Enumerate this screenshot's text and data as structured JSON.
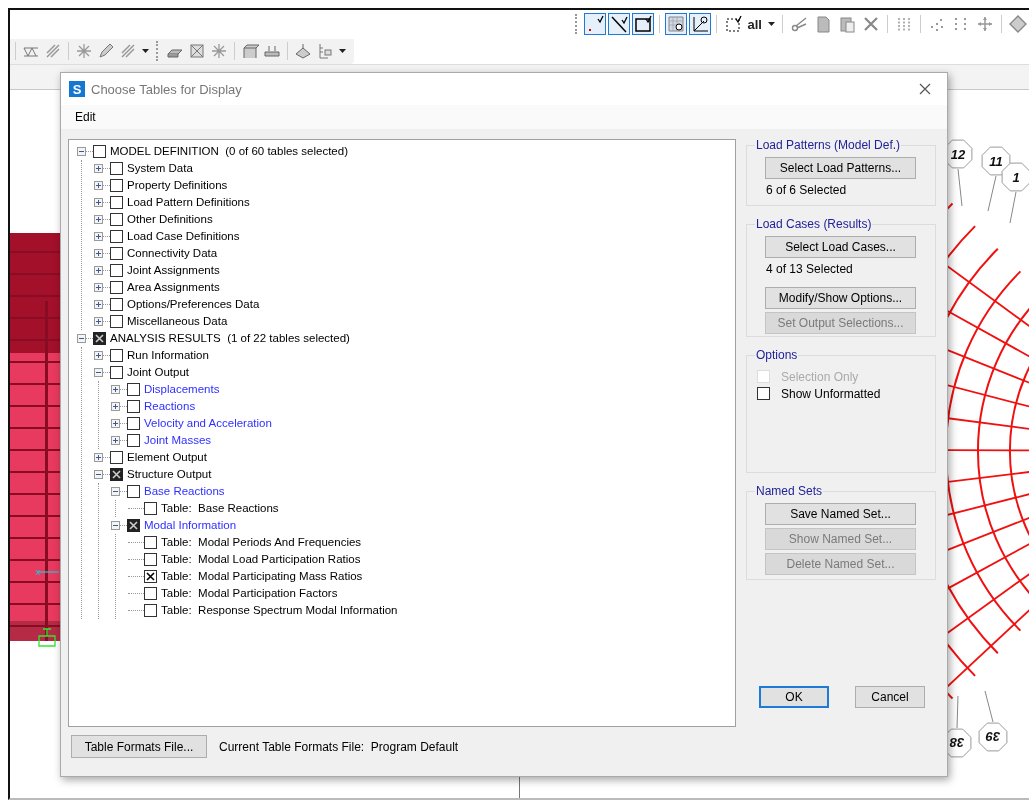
{
  "toolbar": {
    "buttons": [
      {
        "selected": true
      },
      {
        "selected": true
      },
      {
        "selected": true
      },
      {
        "selected": true
      },
      {
        "selected": true
      },
      {
        "selected": false
      },
      {
        "selected": false,
        "label": "all"
      },
      {
        "selected": false
      },
      {
        "selected": false
      },
      {
        "selected": false
      },
      {
        "selected": false
      },
      {
        "selected": false
      },
      {
        "selected": false
      },
      {
        "selected": false
      },
      {
        "selected": false
      }
    ]
  },
  "model_view": {
    "axis_label": "x"
  },
  "plan_view": {
    "top_bubbles": [
      "12",
      "11",
      "1"
    ],
    "bottom_bubbles": [
      "38",
      "39"
    ]
  },
  "dialog": {
    "icon_letter": "S",
    "title": "Choose Tables for Display",
    "menu": [
      "Edit"
    ],
    "tree": [
      {
        "label": "MODEL DEFINITION  (0 of 60 tables selected)",
        "expanded": true,
        "checked": false,
        "color": "#000000",
        "children": [
          {
            "label": "System Data",
            "expanded": false,
            "checked": false,
            "color": "#000000"
          },
          {
            "label": "Property Definitions",
            "expanded": false,
            "checked": false,
            "color": "#000000"
          },
          {
            "label": "Load Pattern Definitions",
            "expanded": false,
            "checked": false,
            "color": "#000000"
          },
          {
            "label": "Other Definitions",
            "expanded": false,
            "checked": false,
            "color": "#000000"
          },
          {
            "label": "Load Case Definitions",
            "expanded": false,
            "checked": false,
            "color": "#000000"
          },
          {
            "label": "Connectivity Data",
            "expanded": false,
            "checked": false,
            "color": "#000000"
          },
          {
            "label": "Joint Assignments",
            "expanded": false,
            "checked": false,
            "color": "#000000"
          },
          {
            "label": "Area Assignments",
            "expanded": false,
            "checked": false,
            "color": "#000000"
          },
          {
            "label": "Options/Preferences Data",
            "expanded": false,
            "checked": false,
            "color": "#000000"
          },
          {
            "label": "Miscellaneous Data",
            "expanded": false,
            "checked": false,
            "color": "#000000"
          }
        ]
      },
      {
        "label": "ANALYSIS RESULTS  (1 of 22 tables selected)",
        "expanded": true,
        "checked": true,
        "mixed": true,
        "color": "#000000",
        "children": [
          {
            "label": "Run Information",
            "expanded": false,
            "checked": false,
            "color": "#000000"
          },
          {
            "label": "Joint Output",
            "expanded": true,
            "checked": false,
            "color": "#000000",
            "children": [
              {
                "label": "Displacements",
                "expanded": false,
                "checked": false,
                "color": "#2f2fff"
              },
              {
                "label": "Reactions",
                "expanded": false,
                "checked": false,
                "color": "#2f2fff"
              },
              {
                "label": "Velocity and Acceleration",
                "expanded": false,
                "checked": false,
                "color": "#2f2fff"
              },
              {
                "label": "Joint Masses",
                "expanded": false,
                "checked": false,
                "color": "#2f2fff"
              }
            ]
          },
          {
            "label": "Element Output",
            "expanded": false,
            "checked": false,
            "color": "#000000"
          },
          {
            "label": "Structure Output",
            "expanded": true,
            "checked": true,
            "mixed": true,
            "color": "#000000",
            "children": [
              {
                "label": "Base Reactions",
                "expanded": true,
                "checked": false,
                "color": "#2f2fff",
                "children": [
                  {
                    "label": "Table:  Base Reactions",
                    "checked": false,
                    "color": "#000000"
                  }
                ]
              },
              {
                "label": "Modal Information",
                "expanded": true,
                "checked": true,
                "mixed": true,
                "color": "#2f2fff",
                "children": [
                  {
                    "label": "Table:  Modal Periods And Frequencies",
                    "checked": false,
                    "color": "#000000"
                  },
                  {
                    "label": "Table:  Modal Load Participation Ratios",
                    "checked": false,
                    "color": "#000000"
                  },
                  {
                    "label": "Table:  Modal Participating Mass Ratios",
                    "checked": true,
                    "color": "#000000"
                  },
                  {
                    "label": "Table:  Modal Participation Factors",
                    "checked": false,
                    "color": "#000000"
                  },
                  {
                    "label": "Table:  Response Spectrum Modal Information",
                    "checked": false,
                    "color": "#000000"
                  }
                ]
              }
            ]
          }
        ]
      }
    ],
    "groups": [
      {
        "title": "Load Patterns (Model Def.)",
        "items": [
          {
            "kind": "button",
            "label": "Select Load Patterns...",
            "disabled": false
          },
          {
            "kind": "text",
            "text": "6 of 6 Selected"
          }
        ]
      },
      {
        "title": "Load Cases (Results)",
        "items": [
          {
            "kind": "button",
            "label": "Select Load Cases...",
            "disabled": false
          },
          {
            "kind": "text",
            "text": "4 of 13 Selected"
          },
          {
            "kind": "button",
            "label": "Modify/Show Options...",
            "disabled": false
          },
          {
            "kind": "button",
            "label": "Set Output Selections...",
            "disabled": true
          }
        ]
      },
      {
        "title": "Options",
        "items": [
          {
            "kind": "checkbox",
            "label": "Selection Only",
            "checked": false,
            "disabled": true
          },
          {
            "kind": "checkbox",
            "label": "Show Unformatted",
            "checked": false,
            "disabled": false
          }
        ]
      },
      {
        "title": "Named Sets",
        "items": [
          {
            "kind": "button",
            "label": "Save Named Set...",
            "disabled": false
          },
          {
            "kind": "button",
            "label": "Show Named Set...",
            "disabled": true
          },
          {
            "kind": "button",
            "label": "Delete Named Set...",
            "disabled": true
          }
        ]
      }
    ],
    "actions": [
      {
        "label": "OK",
        "focused": true
      },
      {
        "label": "Cancel",
        "focused": false
      }
    ],
    "formats_button": "Table Formats File...",
    "formats_status": "Current Table Formats File:  Program Default"
  }
}
